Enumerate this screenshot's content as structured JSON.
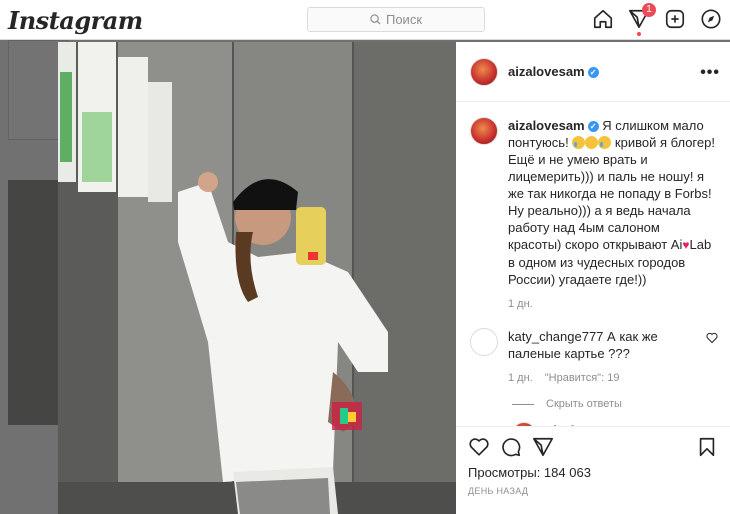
{
  "app": {
    "logo": "Instagram"
  },
  "search": {
    "placeholder": "Поиск"
  },
  "nav": {
    "activity_badge": "1"
  },
  "post": {
    "username": "aizalovesam",
    "caption_parts": [
      "Я слишком мало понтуюсь! ",
      " кривой я блогер! Ещё и не умею врать и лицемерить))) и паль не ношу! я же так никогда не попаду в Forbs! Ну реально))) а я ведь начала работу над 4ым салоном красоты) скоро открывают Ai",
      "Lab в одном из чудесных городов России) угадаете где!))"
    ],
    "caption_time": "1 дн.",
    "comments": [
      {
        "username": "katy_change777",
        "text": "А как же паленые картье ???",
        "time": "1 дн.",
        "likes": "\"Нравится\": 19",
        "hide_replies": "Скрыть ответы",
        "reply_username": "aizalovesam"
      }
    ],
    "views": "Просмотры: 184 063",
    "ago": "ДЕНЬ НАЗАД"
  }
}
